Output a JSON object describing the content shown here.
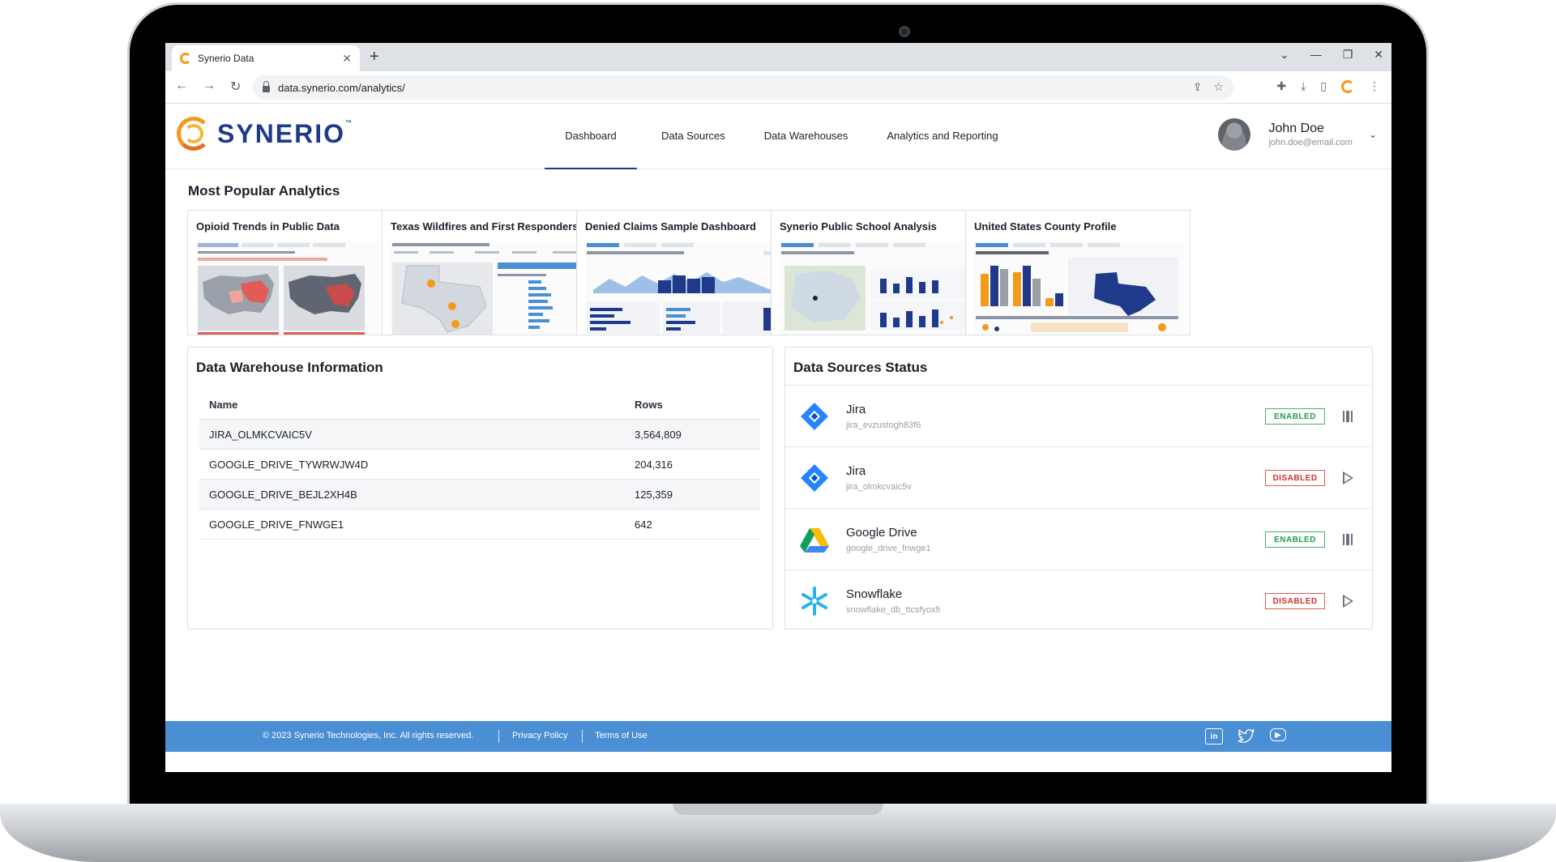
{
  "browser": {
    "tab_title": "Synerio Data",
    "url": "data.synerio.com/analytics/"
  },
  "brand": {
    "name": "SYNERIO",
    "tm": "™",
    "colors": {
      "primary": "#1f3a8a",
      "accent": "#f39a1d",
      "footer": "#4a8fd4"
    }
  },
  "nav": {
    "items": [
      {
        "label": "Dashboard",
        "active": true
      },
      {
        "label": "Data Sources",
        "active": false
      },
      {
        "label": "Data Warehouses",
        "active": false
      },
      {
        "label": "Analytics and Reporting",
        "active": false
      }
    ]
  },
  "user": {
    "name": "John Doe",
    "email": "john.doe@email.com"
  },
  "analytics": {
    "title": "Most Popular Analytics",
    "cards": [
      {
        "title": "Opioid Trends in Public Data"
      },
      {
        "title": "Texas Wildfires and First Responders"
      },
      {
        "title": "Denied Claims Sample Dashboard"
      },
      {
        "title": "Synerio Public School Analysis"
      },
      {
        "title": "United States County Profile"
      }
    ]
  },
  "warehouse": {
    "title": "Data Warehouse Information",
    "columns": {
      "name": "Name",
      "rows": "Rows"
    },
    "rows": [
      {
        "name": "JIRA_OLMKCVAIC5V",
        "rows": "3,564,809"
      },
      {
        "name": "GOOGLE_DRIVE_TYWRWJW4D",
        "rows": "204,316"
      },
      {
        "name": "GOOGLE_DRIVE_BEJL2XH4B",
        "rows": "125,359"
      },
      {
        "name": "GOOGLE_DRIVE_FNWGE1",
        "rows": "642"
      }
    ]
  },
  "sources": {
    "title": "Data Sources Status",
    "items": [
      {
        "name": "Jira",
        "id": "jira_evzustogh83f6",
        "status": "ENABLED",
        "icon": "jira-icon",
        "action": "pause-icon"
      },
      {
        "name": "Jira",
        "id": "jira_olmkcvaic5v",
        "status": "DISABLED",
        "icon": "jira-icon",
        "action": "play-icon"
      },
      {
        "name": "Google Drive",
        "id": "google_drive_fnwge1",
        "status": "ENABLED",
        "icon": "google-drive-icon",
        "action": "pause-icon"
      },
      {
        "name": "Snowflake",
        "id": "snowflake_db_ttcsfyoxfi",
        "status": "DISABLED",
        "icon": "snowflake-icon",
        "action": "play-icon"
      }
    ]
  },
  "footer": {
    "copyright": "© 2023 Synerio Technologies, Inc. All rights reserved.",
    "privacy": "Privacy Policy",
    "terms": "Terms of Use",
    "social": [
      "linkedin-icon",
      "twitter-icon",
      "youtube-icon"
    ]
  }
}
